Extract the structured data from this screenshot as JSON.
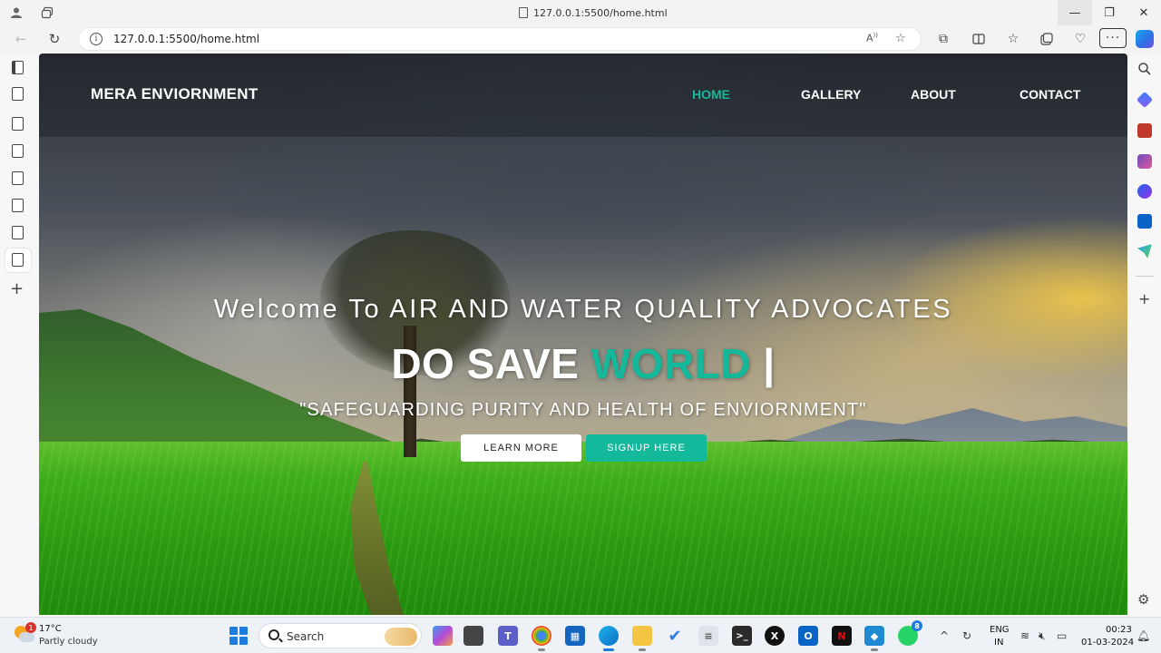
{
  "browser": {
    "tab_title": "127.0.0.1:5500/home.html",
    "url": "127.0.0.1:5500/home.html",
    "window_controls": {
      "minimize": "—",
      "maximize": "❐",
      "close": "✕"
    },
    "more_label": "···"
  },
  "site": {
    "brand": "MERA ENVIORNMENT",
    "nav": [
      {
        "label": "HOME",
        "active": true
      },
      {
        "label": "GALLERY",
        "active": false
      },
      {
        "label": "ABOUT",
        "active": false
      },
      {
        "label": "CONTACT",
        "active": false
      }
    ],
    "welcome": "Welcome To AIR AND WATER QUALITY ADVOCATES",
    "headline_prefix": "DO SAVE ",
    "headline_accent": "WORLD",
    "headline_cursor": " |",
    "tagline": "\"SAFEGUARDING PURITY AND HEALTH OF ENVIORNMENT\"",
    "buttons": {
      "learn_more": "LEARN MORE",
      "signup": "SIGNUP HERE"
    },
    "accent_color": "#14b89a"
  },
  "taskbar": {
    "weather": {
      "badge": "1",
      "temperature": "17°C",
      "condition": "Partly cloudy"
    },
    "search_label": "Search",
    "whatsapp_badge": "8",
    "language": {
      "line1": "ENG",
      "line2": "IN"
    },
    "clock": {
      "time": "00:23",
      "date": "01-03-2024"
    }
  }
}
